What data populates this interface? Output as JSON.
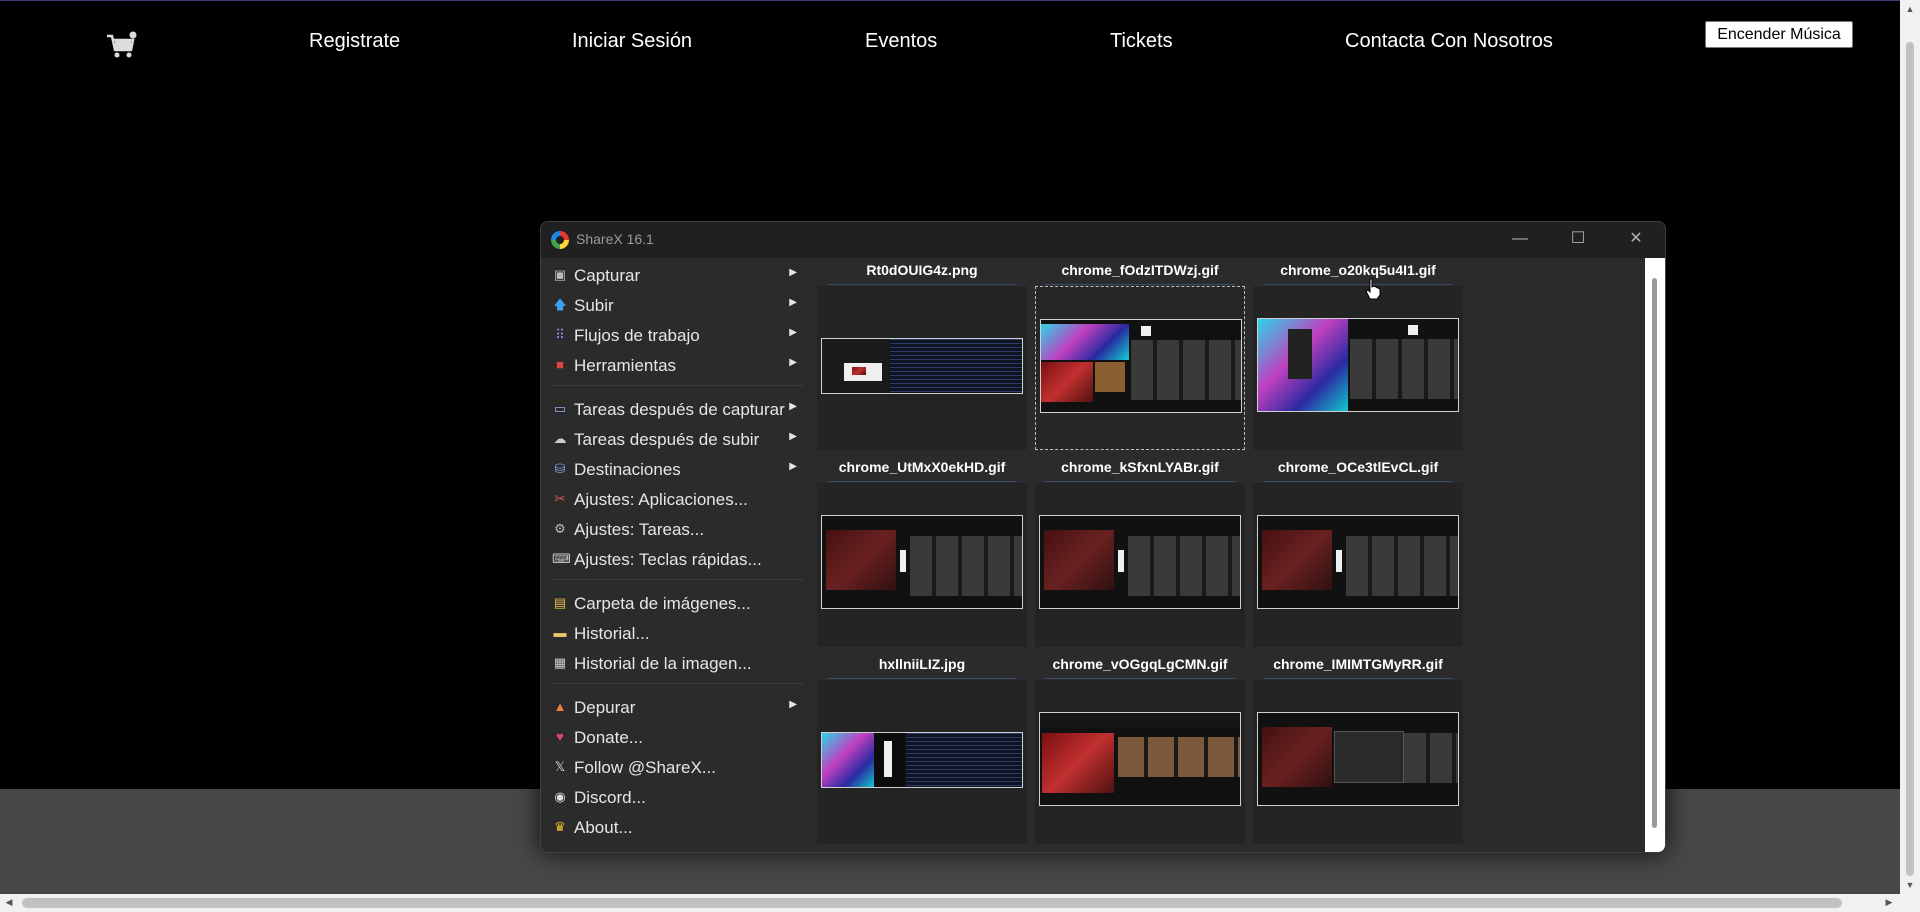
{
  "site": {
    "nav": [
      {
        "label": "Registrate"
      },
      {
        "label": "Iniciar Sesión"
      },
      {
        "label": "Eventos"
      },
      {
        "label": "Tickets"
      },
      {
        "label": "Contacta Con Nosotros"
      }
    ],
    "music_button": "Encender Música",
    "cart_icon": "cart-icon"
  },
  "sharex": {
    "title": "ShareX 16.1",
    "controls": {
      "minimize": "—",
      "maximize": "☐",
      "close": "✕"
    },
    "menu": [
      {
        "label": "Capturar",
        "icon": "camera-icon",
        "submenu": true
      },
      {
        "label": "Subir",
        "icon": "upload-arrow-icon",
        "submenu": true
      },
      {
        "label": "Flujos de trabajo",
        "icon": "grid-icon",
        "submenu": true
      },
      {
        "label": "Herramientas",
        "icon": "toolbox-icon",
        "submenu": true
      },
      {
        "label": "Tareas después de capturar",
        "icon": "image-icon",
        "submenu": true
      },
      {
        "label": "Tareas después de subir",
        "icon": "cloud-icon",
        "submenu": true
      },
      {
        "label": "Destinaciones",
        "icon": "drive-icon",
        "submenu": true
      },
      {
        "label": "Ajustes: Aplicaciones...",
        "icon": "tools-icon",
        "submenu": false
      },
      {
        "label": "Ajustes: Tareas...",
        "icon": "gear-icon",
        "submenu": false
      },
      {
        "label": "Ajustes: Teclas rápidas...",
        "icon": "keyboard-icon",
        "submenu": false
      },
      {
        "label": "Carpeta de imágenes...",
        "icon": "folder-icon",
        "submenu": false
      },
      {
        "label": "Historial...",
        "icon": "history-icon",
        "submenu": false
      },
      {
        "label": "Historial de la imagen...",
        "icon": "image-history-icon",
        "submenu": false
      },
      {
        "label": "Depurar",
        "icon": "cone-icon",
        "submenu": true
      },
      {
        "label": "Donate...",
        "icon": "heart-icon",
        "submenu": false
      },
      {
        "label": "Follow @ShareX...",
        "icon": "x-logo-icon",
        "submenu": false
      },
      {
        "label": "Discord...",
        "icon": "discord-icon",
        "submenu": false
      },
      {
        "label": "About...",
        "icon": "crown-icon",
        "submenu": false
      }
    ],
    "thumbnails": [
      {
        "name": "Rt0dOUIG4z.png"
      },
      {
        "name": "chrome_fOdzITDWzj.gif"
      },
      {
        "name": "chrome_o20kq5u4I1.gif"
      },
      {
        "name": "chrome_UtMxX0ekHD.gif"
      },
      {
        "name": "chrome_kSfxnLYABr.gif"
      },
      {
        "name": "chrome_OCe3tlEvCL.gif"
      },
      {
        "name": "hxllniiLIZ.jpg"
      },
      {
        "name": "chrome_vOGgqLgCMN.gif"
      },
      {
        "name": "chrome_IMIMTGMyRR.gif"
      }
    ]
  }
}
